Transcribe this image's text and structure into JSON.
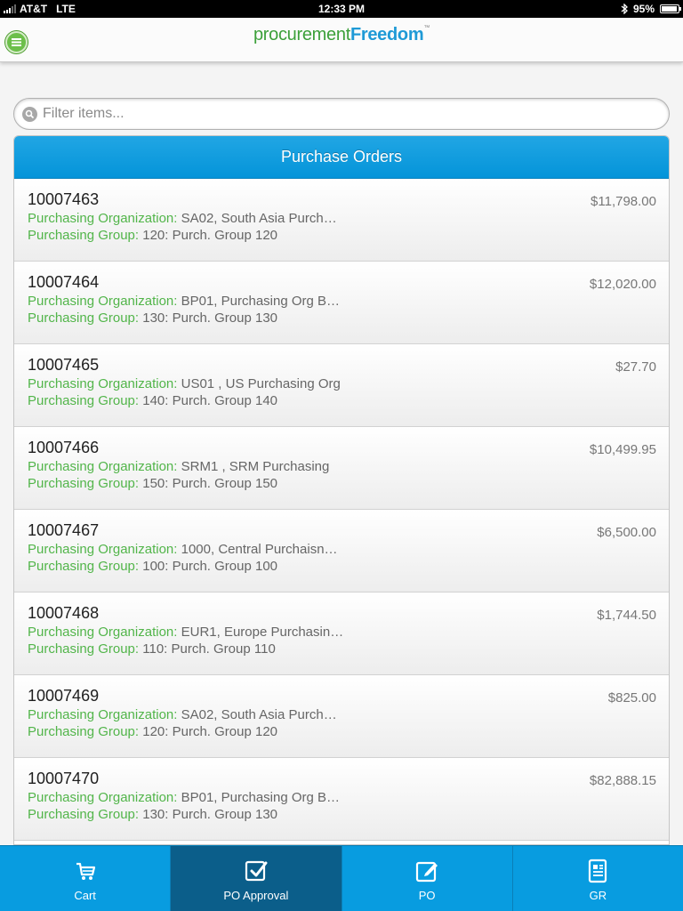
{
  "status": {
    "carrier": "AT&T",
    "network": "LTE",
    "time": "12:33 PM",
    "battery": "95%"
  },
  "header": {
    "logo_light": "procurement",
    "logo_bold": "Freedom",
    "logo_tm": "™"
  },
  "search": {
    "placeholder": "Filter items..."
  },
  "list": {
    "title": "Purchase Orders",
    "org_label": "Purchasing Organization:",
    "group_label": "Purchasing Group:",
    "items": [
      {
        "number": "10007463",
        "org": "SA02, South Asia Purch…",
        "group": "120: Purch. Group 120",
        "amount": "$11,798.00"
      },
      {
        "number": "10007464",
        "org": "BP01, Purchasing Org B…",
        "group": "130: Purch. Group 130",
        "amount": "$12,020.00"
      },
      {
        "number": "10007465",
        "org": "US01 , US Purchasing Org",
        "group": "140: Purch. Group 140",
        "amount": "$27.70"
      },
      {
        "number": "10007466",
        "org": "SRM1 , SRM Purchasing",
        "group": "150: Purch. Group 150",
        "amount": "$10,499.95"
      },
      {
        "number": "10007467",
        "org": "1000, Central Purchaisn…",
        "group": "100: Purch. Group 100",
        "amount": "$6,500.00"
      },
      {
        "number": "10007468",
        "org": "EUR1, Europe Purchasin…",
        "group": "110: Purch. Group 110",
        "amount": "$1,744.50"
      },
      {
        "number": "10007469",
        "org": "SA02, South Asia Purch…",
        "group": "120: Purch. Group 120",
        "amount": "$825.00"
      },
      {
        "number": "10007470",
        "org": "BP01, Purchasing Org B…",
        "group": "130: Purch. Group 130",
        "amount": "$82,888.15"
      }
    ]
  },
  "tabs": [
    {
      "label": "Cart",
      "icon": "cart-icon",
      "active": false
    },
    {
      "label": "PO Approval",
      "icon": "approval-check-icon",
      "active": true
    },
    {
      "label": "PO",
      "icon": "edit-icon",
      "active": false
    },
    {
      "label": "GR",
      "icon": "document-icon",
      "active": false
    }
  ],
  "colors": {
    "brand_blue": "#0494d9",
    "brand_green": "#52b54a",
    "active_tab": "#0b5e8a"
  }
}
